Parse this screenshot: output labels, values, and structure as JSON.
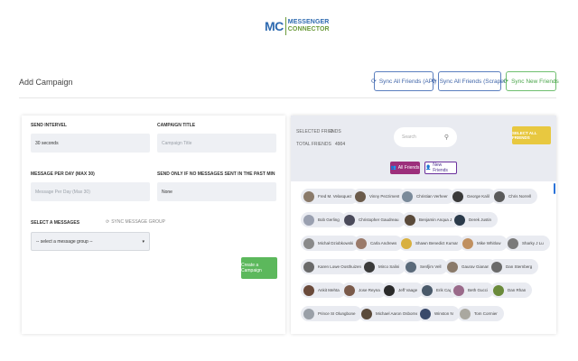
{
  "logo": {
    "mark": "MC",
    "line1": "MESSENGER",
    "line2": "CONNECTOR"
  },
  "header": {
    "title": "Add Campaign",
    "sync_api": "Sync All Friends (API)",
    "sync_scraper": "Sync All Friends (Scraper)",
    "sync_new": "Sync New Friends"
  },
  "form": {
    "send_interval_label": "SEND INTERVEL",
    "send_interval_value": "30 seconds",
    "campaign_title_label": "CAMPAIGN TITLE",
    "campaign_title_placeholder": "Campaign Title",
    "message_per_day_label": "MESSAGE PER DAY (MAX 30)",
    "message_per_day_placeholder": "Message Per Day (Max 30)",
    "send_only_label": "SEND ONLY IF NO MESSAGES SENT IN THE PAST MIN",
    "send_only_value": "None",
    "select_messages_label": "SELECT A MESSAGES",
    "sync_message_group": "SYNC MESSAGE GROUP",
    "message_group_selected": "-- select a message group --",
    "create_button": "Create a Campaign"
  },
  "friends_panel": {
    "selected_label": "SELECTED FRIENDS",
    "selected_value": "0",
    "total_label": "TOTAL FRIENDS",
    "total_value": "4904",
    "search_placeholder": "Search",
    "select_all": "SELECT ALL FRIENDS",
    "tab_all": "All Friends",
    "tab_new": "New Friends"
  },
  "friends": [
    {
      "name": "Fred M. Velasquez",
      "color": "#8a7a6a"
    },
    {
      "name": "Vinny Pezzimenti",
      "color": "#6a5a4a"
    },
    {
      "name": "Christian Verheer",
      "color": "#7a8a9a"
    },
    {
      "name": "George Kalil",
      "color": "#3a3a3a"
    },
    {
      "name": "Chris Norrell",
      "color": "#5a5a5a"
    },
    {
      "name": "Bob Gerling",
      "color": "#9aa0b0"
    },
    {
      "name": "Christopher Gaudreau",
      "color": "#4a4a5a"
    },
    {
      "name": "Benjamin Anqua Jr",
      "color": "#5a4a3a"
    },
    {
      "name": "Derek Justin",
      "color": "#2a3a4a"
    },
    {
      "name": "Michał Dziobkowski",
      "color": "#8a8a8a"
    },
    {
      "name": "Carla Andrews",
      "color": "#9a7a6a"
    },
    {
      "name": "Shawn Benedict Kumar",
      "color": "#d8b040"
    },
    {
      "name": "Mike Whitlow",
      "color": "#c09060"
    },
    {
      "name": "Sharky J Lu",
      "color": "#7a7a7a"
    },
    {
      "name": "Karen Lowe Oosthuizen",
      "color": "#6a6a6a"
    },
    {
      "name": "Mirco Salini",
      "color": "#3a3a3a"
    },
    {
      "name": "Senfjim Vell",
      "color": "#5a6a7a"
    },
    {
      "name": "Gaurav Gianani",
      "color": "#8a7a6a"
    },
    {
      "name": "Dan Sternberg",
      "color": "#6a6a6a"
    },
    {
      "name": "Ankit Mehta",
      "color": "#6a4a3a"
    },
    {
      "name": "Jose Reyna",
      "color": "#7a5a4a"
    },
    {
      "name": "Jeff Vaage",
      "color": "#2a2a2a"
    },
    {
      "name": "Erik Cagi",
      "color": "#4a5a6a"
    },
    {
      "name": "Beth Gucci",
      "color": "#9a6a8a"
    },
    {
      "name": "Dan Rhan",
      "color": "#6a8a3a"
    },
    {
      "name": "Prince SI Olungbone",
      "color": "#9aa0a8"
    },
    {
      "name": "Michael Aaron Osborne",
      "color": "#5a4a3a"
    },
    {
      "name": "Winston N",
      "color": "#3a4a6a"
    },
    {
      "name": "Tom Cormier",
      "color": "#aaa8a0"
    }
  ]
}
